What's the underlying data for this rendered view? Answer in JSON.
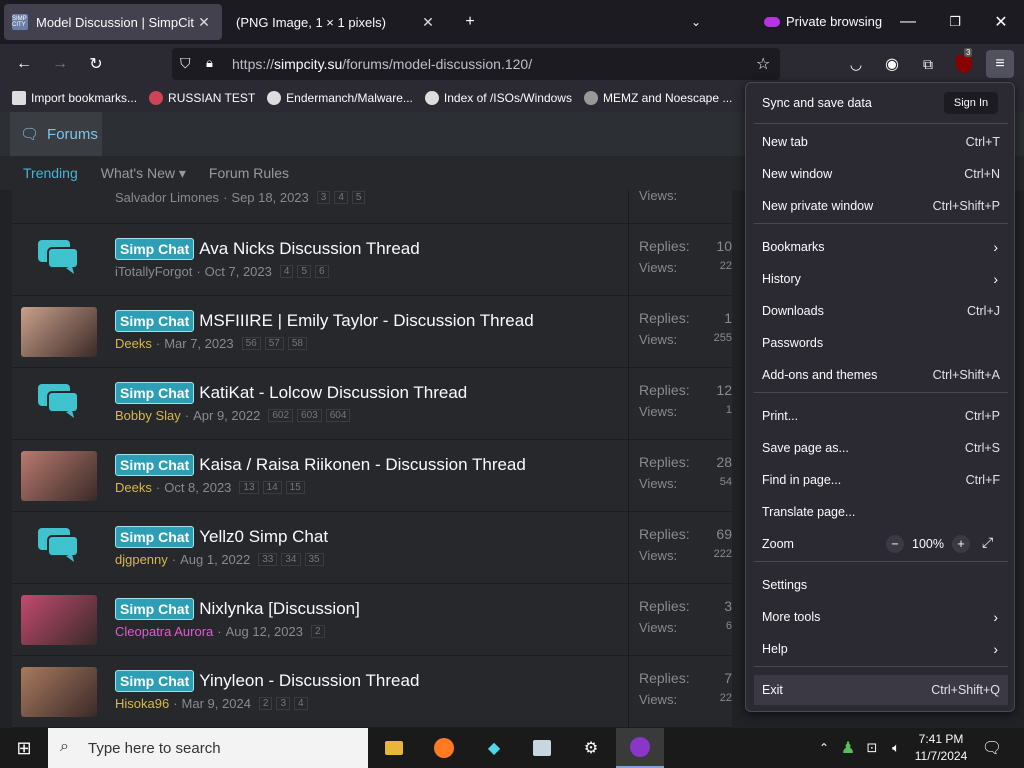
{
  "tabs": [
    {
      "title": "Model Discussion | SimpCity Fo",
      "favicon": "SIMP CITY"
    },
    {
      "title": "(PNG Image, 1 × 1 pixels)"
    }
  ],
  "private_label": "Private browsing",
  "address": {
    "prefix": "https://",
    "host": "simpcity.su",
    "path": "/forums/model-discussion.120/"
  },
  "ext_badge": "3",
  "bookmarks": [
    "Import bookmarks...",
    "RUSSIAN TEST",
    "Endermanch/Malware...",
    "Index of /ISOs/Windows",
    "MEMZ and Noescape ..."
  ],
  "forum": {
    "tab": "Forums",
    "subnav": [
      "Trending",
      "What's New",
      "Forum Rules"
    ],
    "top_partial": {
      "user": "Salvador Limones",
      "date": "Sep 18, 2023",
      "pages": [
        "3",
        "4",
        "5"
      ],
      "views_label": "Views:"
    },
    "badge": "Simp Chat",
    "replies_label": "Replies:",
    "views_label": "Views:",
    "threads": [
      {
        "title": "Ava Nicks Discussion Thread",
        "user": "iTotallyForgot",
        "date": "Oct 7, 2023",
        "pages": [
          "4",
          "5",
          "6"
        ],
        "replies": "10",
        "views": "22",
        "thumb": "chat"
      },
      {
        "title": "MSFIIIRE | Emily Taylor - Discussion Thread",
        "user": "Deeks",
        "date": "Mar 7, 2023",
        "pages": [
          "56",
          "57",
          "58"
        ],
        "replies": "1",
        "views": "255",
        "thumb": "photo"
      },
      {
        "title": "KatiKat - Lolcow Discussion Thread",
        "user": "Bobby Slay",
        "date": "Apr 9, 2022",
        "pages": [
          "602",
          "603",
          "604"
        ],
        "replies": "12",
        "views": "1",
        "thumb": "chat"
      },
      {
        "title": "Kaisa / Raisa Riikonen - Discussion Thread",
        "user": "Deeks",
        "date": "Oct 8, 2023",
        "pages": [
          "13",
          "14",
          "15"
        ],
        "replies": "28",
        "views": "54",
        "thumb": "photo"
      },
      {
        "title": "Yellz0 Simp Chat",
        "user": "djgpenny",
        "date": "Aug 1, 2022",
        "pages": [
          "33",
          "34",
          "35"
        ],
        "replies": "69",
        "views": "222",
        "thumb": "chat"
      },
      {
        "title": "Nixlynka [Discussion]",
        "user": "Cleopatra Aurora",
        "date": "Aug 12, 2023",
        "pages": [
          "2"
        ],
        "replies": "3",
        "views": "6",
        "thumb": "photo"
      },
      {
        "title": "Yinyleon - Discussion Thread",
        "user": "Hisoka96",
        "date": "Mar 9, 2024",
        "pages": [
          "2",
          "3",
          "4"
        ],
        "replies": "7",
        "views": "22",
        "thumb": "photo"
      }
    ]
  },
  "menu": {
    "sync": "Sync and save data",
    "signin": "Sign In",
    "items": [
      {
        "label": "New tab",
        "shortcut": "Ctrl+T"
      },
      {
        "label": "New window",
        "shortcut": "Ctrl+N"
      },
      {
        "label": "New private window",
        "shortcut": "Ctrl+Shift+P"
      },
      {
        "label": "Bookmarks",
        "arrow": true
      },
      {
        "label": "History",
        "arrow": true
      },
      {
        "label": "Downloads",
        "shortcut": "Ctrl+J"
      },
      {
        "label": "Passwords"
      },
      {
        "label": "Add-ons and themes",
        "shortcut": "Ctrl+Shift+A"
      },
      {
        "label": "Print...",
        "shortcut": "Ctrl+P"
      },
      {
        "label": "Save page as...",
        "shortcut": "Ctrl+S"
      },
      {
        "label": "Find in page...",
        "shortcut": "Ctrl+F"
      },
      {
        "label": "Translate page..."
      },
      {
        "label": "Zoom"
      },
      {
        "label": "Settings"
      },
      {
        "label": "More tools",
        "arrow": true
      },
      {
        "label": "Help",
        "arrow": true
      },
      {
        "label": "Exit",
        "shortcut": "Ctrl+Shift+Q"
      }
    ],
    "zoom_level": "100%"
  },
  "taskbar": {
    "search_placeholder": "Type here to search",
    "time": "7:41 PM",
    "date": "11/7/2024"
  },
  "colors": {
    "accent": "#2d9fb5",
    "link": "#4ab2d6",
    "user_gold": "#d8b84a",
    "user_pink": "#e05ad2"
  }
}
